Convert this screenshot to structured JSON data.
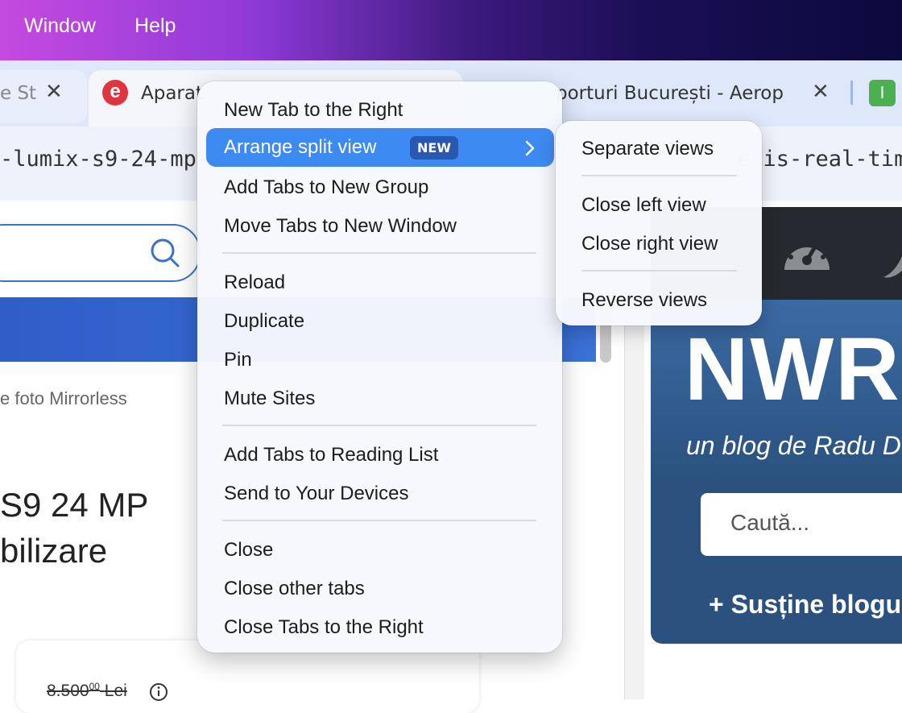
{
  "menubar": {
    "items": [
      "Window",
      "Help"
    ]
  },
  "tabs": [
    {
      "label": "e St",
      "close": "✕"
    },
    {
      "label": "Aparat",
      "close": ""
    },
    {
      "label": "porturi București - Aerop",
      "close": "✕"
    }
  ],
  "favicon_letter": "e",
  "ext_tab_icon": "Ⅰ",
  "url_left": "-lumix-s9-24-mp-",
  "url_right": "e-is-real-time",
  "left_page": {
    "crumb": "e foto Mirrorless",
    "title_line1": "S9 24 MP",
    "title_line2": "bilizare",
    "price": "8.500",
    "price_cents": "00",
    "price_currency": "Lei"
  },
  "right_page": {
    "logo": "NWR",
    "tagline": "un blog de Radu D",
    "search_placeholder": "Caută...",
    "support": "+ Susține blogu"
  },
  "context_menu": {
    "items": [
      "New Tab to the Right",
      "Arrange split view",
      "Add Tabs to New Group",
      "Move Tabs to New Window",
      "Reload",
      "Duplicate",
      "Pin",
      "Mute Sites",
      "Add Tabs to Reading List",
      "Send to Your Devices",
      "Close",
      "Close other tabs",
      "Close Tabs to the Right"
    ],
    "badge": "NEW",
    "highlighted_index": 1
  },
  "submenu": {
    "items": [
      "Separate views",
      "Close left view",
      "Close right view",
      "Reverse views"
    ]
  },
  "colors": {
    "highlight": "#3d8bf2",
    "badge": "#2a58b0",
    "accent_blue": "#3b72c8"
  }
}
